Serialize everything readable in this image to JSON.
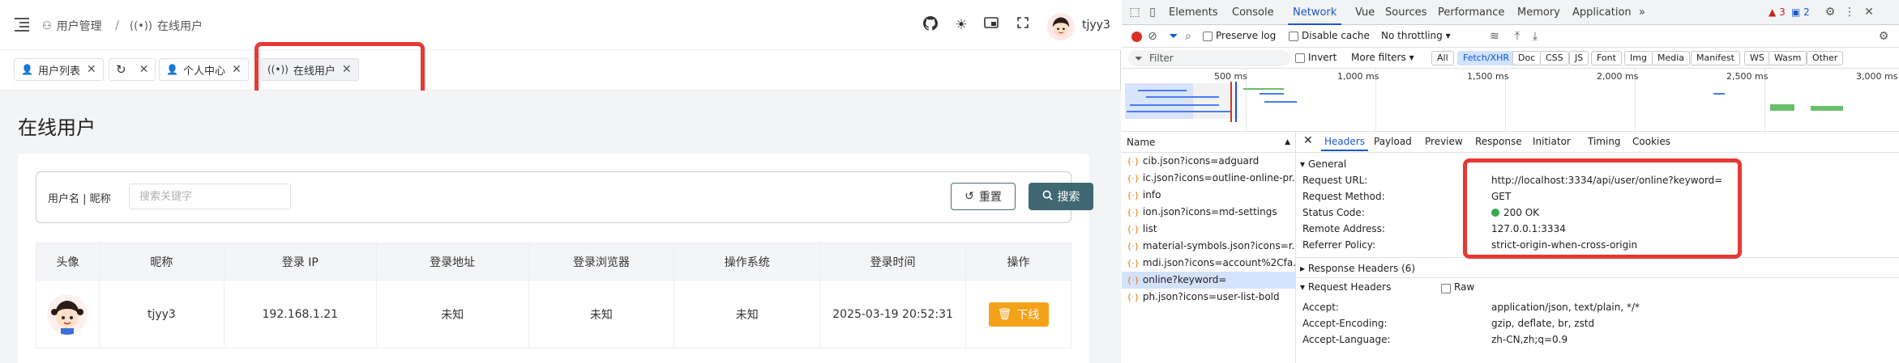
{
  "app": {
    "breadcrumb": [
      {
        "label": "用户管理"
      },
      {
        "label": "在线用户"
      }
    ],
    "user": {
      "name": "tjyy3"
    },
    "tabs": [
      {
        "label": "用户列表"
      },
      {
        "label": ""
      },
      {
        "label": "个人中心"
      },
      {
        "label": "在线用户"
      }
    ],
    "page_title": "在线用户",
    "search": {
      "label": "用户名 | 昵称",
      "placeholder": "搜索关键字",
      "reset_label": "重置",
      "search_label": "搜索"
    },
    "table": {
      "headers": [
        "头像",
        "昵称",
        "登录 IP",
        "登录地址",
        "登录浏览器",
        "操作系统",
        "登录时间",
        "操作"
      ],
      "rows": [
        {
          "nickname": "tjyy3",
          "ip": "192.168.1.21",
          "address": "未知",
          "browser": "未知",
          "os": "未知",
          "time": "2025-03-19 20:52:31",
          "action": "下线"
        }
      ]
    }
  },
  "devtools": {
    "tabs": [
      "Elements",
      "Console",
      "Network",
      "Vue",
      "Sources",
      "Performance",
      "Memory",
      "Application"
    ],
    "active_tab": "Network",
    "warnings": "3",
    "messages": "2",
    "toolbar": {
      "preserve_log": "Preserve log",
      "disable_cache": "Disable cache",
      "throttling": "No throttling"
    },
    "filter": {
      "placeholder": "Filter",
      "invert": "Invert",
      "more_filters": "More filters",
      "chips": [
        "All",
        "Fetch/XHR",
        "Doc",
        "CSS",
        "JS",
        "Font",
        "Img",
        "Media",
        "Manifest",
        "WS",
        "Wasm",
        "Other"
      ],
      "active_chip": "Fetch/XHR"
    },
    "timeline_labels": [
      "500 ms",
      "1,000 ms",
      "1,500 ms",
      "2,000 ms",
      "2,500 ms",
      "3,000 ms"
    ],
    "requests_header": "Name",
    "requests": [
      "cib.json?icons=adguard",
      "ic.json?icons=outline-online-pr...",
      "info",
      "ion.json?icons=md-settings",
      "list",
      "material-symbols.json?icons=r...",
      "mdi.json?icons=account%2Cfa...",
      "online?keyword=",
      "ph.json?icons=user-list-bold"
    ],
    "selected_request": "online?keyword=",
    "detail_tabs": [
      "Headers",
      "Payload",
      "Preview",
      "Response",
      "Initiator",
      "Timing",
      "Cookies"
    ],
    "active_detail_tab": "Headers",
    "general": {
      "title": "General",
      "rows": [
        {
          "key": "Request URL:",
          "value": "http://localhost:3334/api/user/online?keyword="
        },
        {
          "key": "Request Method:",
          "value": "GET"
        },
        {
          "key": "Status Code:",
          "value": "200 OK"
        },
        {
          "key": "Remote Address:",
          "value": "127.0.0.1:3334"
        },
        {
          "key": "Referrer Policy:",
          "value": "strict-origin-when-cross-origin"
        }
      ]
    },
    "response_headers_title": "Response Headers (6)",
    "request_headers": {
      "title": "Request Headers",
      "raw_label": "Raw",
      "rows": [
        {
          "key": "Accept:",
          "value": "application/json, text/plain, */*"
        },
        {
          "key": "Accept-Encoding:",
          "value": "gzip, deflate, br, zstd"
        },
        {
          "key": "Accept-Language:",
          "value": "zh-CN,zh;q=0.9"
        }
      ]
    },
    "colors": {
      "accent": "#1a57d1",
      "highlight": "#e53935",
      "primary_btn": "#3f6872",
      "warn_btn": "#f5a21b"
    }
  }
}
